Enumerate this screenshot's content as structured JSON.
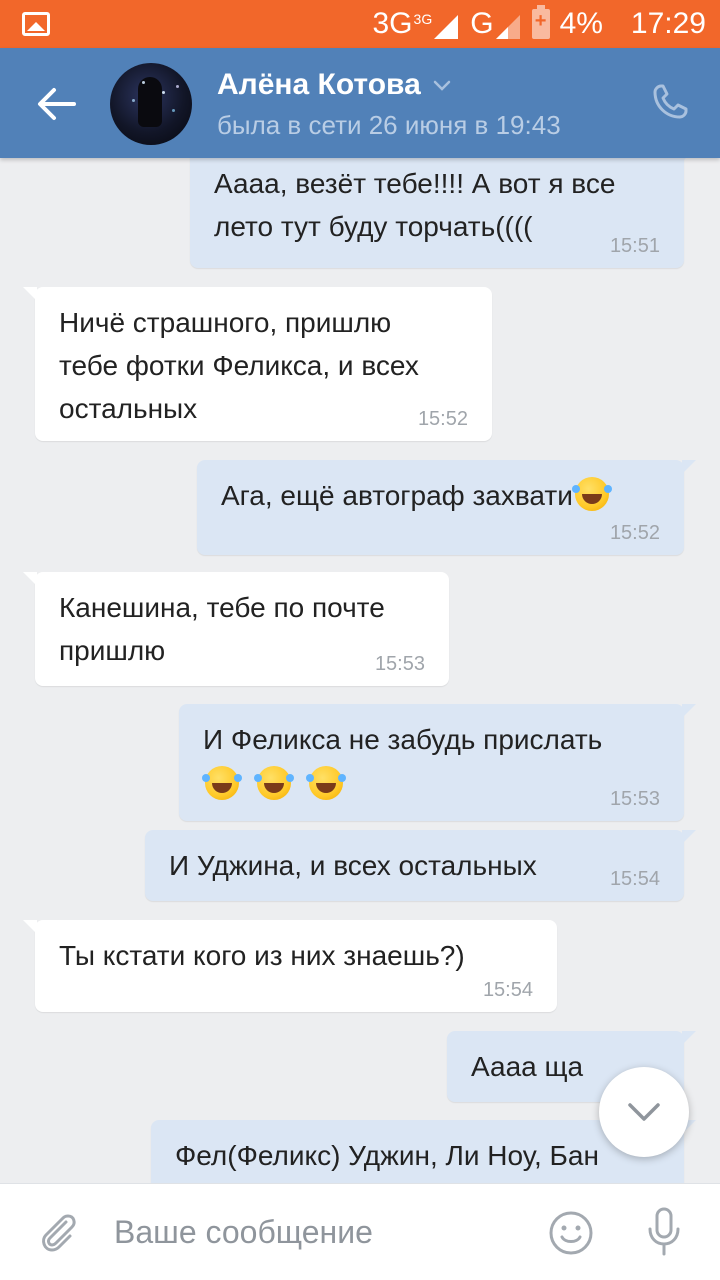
{
  "statusbar": {
    "network_3g": "3G",
    "network_3g_small": "3G",
    "network_g": "G",
    "battery": "4%",
    "time": "17:29"
  },
  "header": {
    "name": "Алёна Котова",
    "status": "была в сети 26 июня в 19:43"
  },
  "messages": [
    {
      "dir": "out",
      "lines": [
        "Аааа, везёт тебе!!!! А вот я все",
        "лето тут буду торчать(((("
      ],
      "time": "15:51"
    },
    {
      "dir": "in",
      "lines": [
        "Ничё страшного, пришлю",
        "тебе фотки Феликса, и всех",
        "остальных"
      ],
      "time": "15:52"
    },
    {
      "dir": "out",
      "lines": [
        "Ага, ещё автограф захвати"
      ],
      "time": "15:52"
    },
    {
      "dir": "in",
      "lines": [
        "Канешина, тебе по почте",
        "пришлю"
      ],
      "time": "15:53"
    },
    {
      "dir": "out",
      "lines": [
        "И Феликса не забудь прислать"
      ],
      "time": "15:53"
    },
    {
      "dir": "out",
      "lines": [
        "И Уджина, и всех остальных"
      ],
      "time": "15:54"
    },
    {
      "dir": "in",
      "lines": [
        "Ты  кстати кого из них знаешь?)"
      ],
      "time": "15:54"
    },
    {
      "dir": "out",
      "lines": [
        "Аааа ща"
      ],
      "time": ""
    },
    {
      "dir": "out",
      "lines": [
        "Фел(Феликс) Уджин, Ли Ноу, Бан"
      ],
      "time": ""
    }
  ],
  "input": {
    "placeholder": "Ваше сообщение"
  },
  "icons": {
    "back": "arrow-left-icon",
    "phone": "phone-icon",
    "attach": "paperclip-icon",
    "emoji": "smile-icon",
    "mic": "microphone-icon",
    "scroll": "chevron-down-icon",
    "laugh_emoji": "rofl-emoji-icon"
  },
  "colors": {
    "statusbar": "#f2672a",
    "header": "#5181b8",
    "background": "#edeef0",
    "incoming_bubble": "#ffffff",
    "outgoing_bubble": "#dbe6f4"
  }
}
